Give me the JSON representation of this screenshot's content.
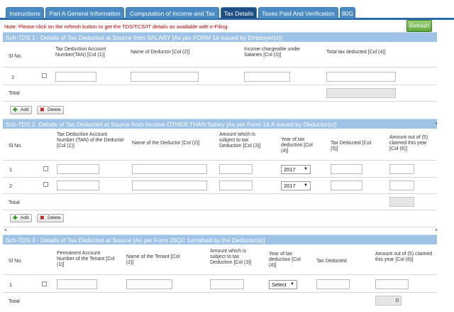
{
  "tabs": [
    {
      "label": "Instructions"
    },
    {
      "label": "Part A General Information"
    },
    {
      "label": "Computation of Income and Tax"
    },
    {
      "label": "Tax Details",
      "active": true
    },
    {
      "label": "Taxes Paid And Verification"
    },
    {
      "label": "80G"
    }
  ],
  "note": "Note: Please click on the refresh button to get the TDS/TCS/IT details as available with e-Filing.",
  "refresh_label": "Refresh",
  "tds1": {
    "title": "Sch-TDS 1 - Details of Tax Deducted at Source from SALARY [As per FORM 16 issued by Employer(s)]",
    "headers": [
      "Sl No.",
      "Tax Deduction Account Number(TAN) [Col (1)]",
      "Name of Deductor [Col (2)]",
      "Income chargeable under Salaries [Col (3)]",
      "Total tax deducted [Col (4)]"
    ],
    "rows": [
      {
        "sl": "1"
      }
    ],
    "total_label": "Total",
    "add_label": "Add",
    "delete_label": "Delete"
  },
  "tds2": {
    "title": "Sch-TDS 2 -Details of Tax Deducted at Source from Income OTHER THAN Salary [As per Form 16 A issued by Deductor(s)]",
    "headers": [
      "Sl No.",
      "Tax Deduction Account Number (TAN) of the Deductor [Col (1)]",
      "Name of the Deductor [Col (2)]",
      "Amount which is subject to tax Deduction [Col (3)]",
      "Year of tax deduction [Col (4)]",
      "Tax Deducted [Col (5)]",
      "Amount out of (5) claimed this year [Col (6)]"
    ],
    "rows": [
      {
        "sl": "1",
        "year": "2017"
      },
      {
        "sl": "2",
        "year": "2017"
      }
    ],
    "total_label": "Total",
    "add_label": "Add",
    "delete_label": "Delete"
  },
  "tds3": {
    "title": "Sch-TDS 3 - Details of Tax Deducted at Source [As per Form 26QC furnished by the Deductor(s)]",
    "headers": [
      "Sl No.",
      "Permanent Account Number of the Tenant [Col (1)]",
      "Name of the Tenant [Col (2)]",
      "Amount which is subject to tax Deduction [Col (3)]",
      "Year of tax deduction [Col (4)]",
      "Tax Deducted",
      "Amount out of (5) claimed this year [Col (6)]"
    ],
    "rows": [
      {
        "sl": "1",
        "year": "Select"
      }
    ],
    "total_label": "Total",
    "total_value": "0"
  },
  "colors": {
    "tab": "#4a8bc6",
    "tab_active": "#1f4f82",
    "section_header": "#9fc3e6",
    "refresh": "#5fa83c",
    "note": "#cc0000"
  }
}
